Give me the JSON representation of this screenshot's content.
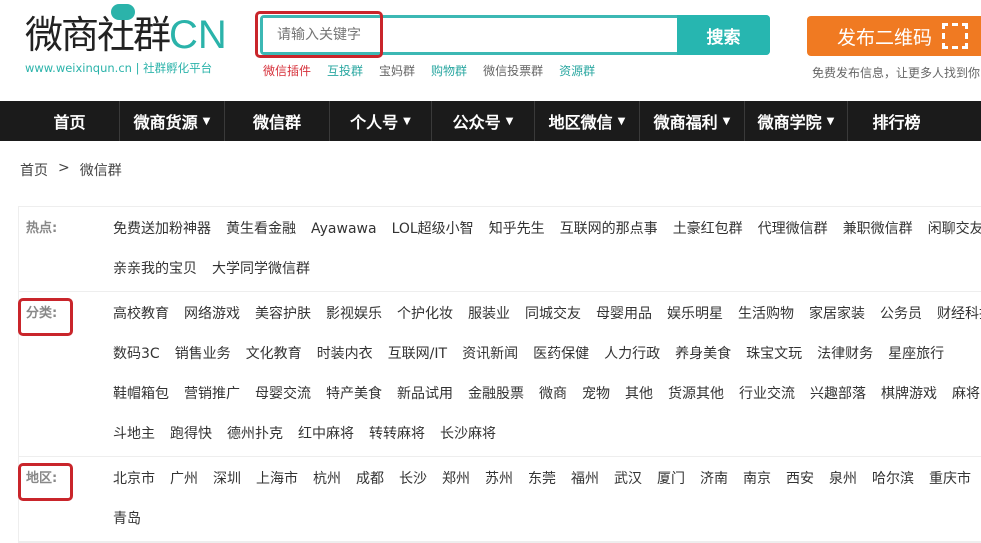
{
  "logo": {
    "main": "微商社群",
    "cn": "CN",
    "sub": "www.weixinqun.cn | 社群孵化平台"
  },
  "search": {
    "placeholder": "请输入关键字",
    "button": "搜索"
  },
  "hot_links": [
    {
      "label": "微信插件",
      "color": "#d6303a"
    },
    {
      "label": "互投群",
      "color": "#2aa7a1"
    },
    {
      "label": "宝妈群",
      "color": "#666666"
    },
    {
      "label": "购物群",
      "color": "#2aa7a1"
    },
    {
      "label": "微信投票群",
      "color": "#666666"
    },
    {
      "label": "资源群",
      "color": "#2aa7a1"
    }
  ],
  "publish": {
    "button": "发布二维码",
    "tip": "免费发布信息，让更多人找到你"
  },
  "nav": [
    {
      "label": "首页",
      "dropdown": false
    },
    {
      "label": "微商货源",
      "dropdown": true
    },
    {
      "label": "微信群",
      "dropdown": false
    },
    {
      "label": "个人号",
      "dropdown": true
    },
    {
      "label": "公众号",
      "dropdown": true
    },
    {
      "label": "地区微信",
      "dropdown": true
    },
    {
      "label": "微商福利",
      "dropdown": true
    },
    {
      "label": "微商学院",
      "dropdown": true
    },
    {
      "label": "排行榜",
      "dropdown": false
    }
  ],
  "breadcrumb": {
    "home": "首页",
    "sep": ">",
    "current": "微信群"
  },
  "rows": [
    {
      "label": "热点:",
      "tags": [
        "免费送加粉神器",
        "黄生看金融",
        "Ayawawa",
        "LOL超级小智",
        "知乎先生",
        "互联网的那点事",
        "土豪红包群",
        "代理微信群",
        "兼职微信群",
        "闲聊交友群",
        "亲亲我的宝贝",
        "大学同学微信群"
      ]
    },
    {
      "label": "分类:",
      "tags": [
        "高校教育",
        "网络游戏",
        "美容护肤",
        "影视娱乐",
        "个护化妆",
        "服装业",
        "同城交友",
        "母婴用品",
        "娱乐明星",
        "生活购物",
        "家居家装",
        "公务员",
        "财经科技",
        "数码3C",
        "销售业务",
        "文化教育",
        "时装内衣",
        "互联网/IT",
        "资讯新闻",
        "医药保健",
        "人力行政",
        "养身美食",
        "珠宝文玩",
        "法律财务",
        "星座旅行",
        "鞋帽箱包",
        "营销推广",
        "母婴交流",
        "特产美食",
        "新品试用",
        "金融股票",
        "微商",
        "宠物",
        "其他",
        "货源其他",
        "行业交流",
        "兴趣部落",
        "棋牌游戏",
        "麻将",
        "斗地主",
        "跑得快",
        "德州扑克",
        "红中麻将",
        "转转麻将",
        "长沙麻将"
      ]
    },
    {
      "label": "地区:",
      "tags": [
        "北京市",
        "广州",
        "深圳",
        "上海市",
        "杭州",
        "成都",
        "长沙",
        "郑州",
        "苏州",
        "东莞",
        "福州",
        "武汉",
        "厦门",
        "济南",
        "南京",
        "西安",
        "泉州",
        "哈尔滨",
        "重庆市",
        "青岛"
      ]
    }
  ]
}
